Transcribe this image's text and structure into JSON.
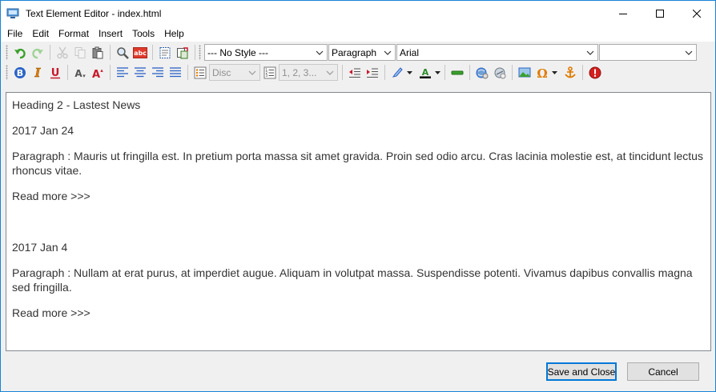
{
  "window": {
    "title": "Text Element Editor - index.html"
  },
  "menu": [
    "File",
    "Edit",
    "Format",
    "Insert",
    "Tools",
    "Help"
  ],
  "toolbar": {
    "style_combo": "--- No Style ---",
    "block_combo": "Paragraph",
    "font_combo": "Arial",
    "size_combo": "",
    "bullet_combo": "Disc",
    "numbering_combo": "1, 2, 3..."
  },
  "editor": {
    "heading": "Heading 2 - Lastest News",
    "post1_date": "2017 Jan 24",
    "post1_paragraph": "Paragraph : Mauris ut fringilla est. In pretium porta massa sit amet gravida. Proin sed odio arcu. Cras lacinia molestie est, at tincidunt lectus rhoncus vitae.",
    "post1_readmore": "Read more >>>",
    "post2_date": "2017 Jan 4",
    "post2_paragraph": "Paragraph : Nullam at erat purus, at imperdiet augue. Aliquam in volutpat massa. Suspendisse potenti. Vivamus dapibus convallis magna sed fringilla.",
    "post2_readmore": "Read more >>>"
  },
  "buttons": {
    "save": "Save and Close",
    "cancel": "Cancel"
  },
  "colors": {
    "window_border": "#1883d7",
    "undo_green": "#3aa02c",
    "bold_blue": "#2b63c7",
    "italic_orange": "#e07b00",
    "underline_red": "#c8182c",
    "help_red": "#d42020"
  }
}
